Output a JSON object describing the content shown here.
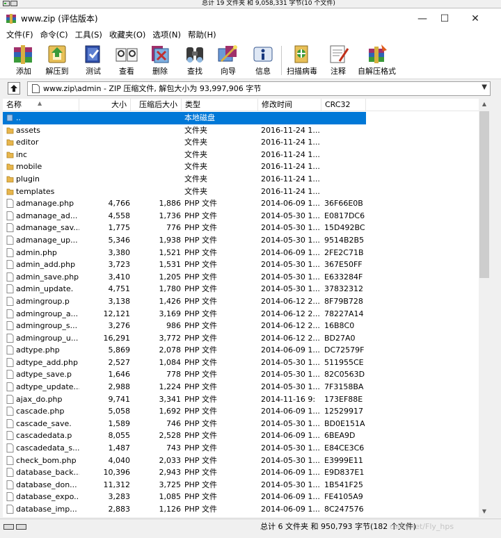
{
  "top_strip": {
    "text": "总计 19 文件夹 和 9,058,331 字节(10 个文件)"
  },
  "window": {
    "title": "www.zip (评估版本)",
    "controls": {
      "minimize": "—",
      "maximize": "☐",
      "close": "✕"
    }
  },
  "menu": [
    "文件(F)",
    "命令(C)",
    "工具(S)",
    "收藏夹(O)",
    "选项(N)",
    "帮助(H)"
  ],
  "toolbar": [
    {
      "label": "添加",
      "icon": "add-icon"
    },
    {
      "label": "解压到",
      "icon": "extract-to-icon"
    },
    {
      "label": "测试",
      "icon": "test-icon"
    },
    {
      "label": "查看",
      "icon": "view-icon"
    },
    {
      "label": "删除",
      "icon": "delete-icon"
    },
    {
      "label": "查找",
      "icon": "find-icon"
    },
    {
      "label": "向导",
      "icon": "wizard-icon"
    },
    {
      "label": "信息",
      "icon": "info-icon"
    },
    {
      "label": "扫描病毒",
      "icon": "virus-scan-icon"
    },
    {
      "label": "注释",
      "icon": "comment-icon"
    },
    {
      "label": "自解压格式",
      "icon": "sfx-icon"
    }
  ],
  "address": {
    "text": "www.zip\\admin - ZIP 压缩文件, 解包大小为 93,997,906 字节"
  },
  "columns": {
    "name": "名称",
    "size": "大小",
    "packed": "压缩后大小",
    "type": "类型",
    "modified": "修改时间",
    "crc": "CRC32"
  },
  "rows": [
    {
      "kind": "up",
      "name": "..",
      "size": "",
      "packed": "",
      "type": "本地磁盘",
      "modified": "",
      "crc": "",
      "selected": true
    },
    {
      "kind": "folder",
      "name": "assets",
      "size": "",
      "packed": "",
      "type": "文件夹",
      "modified": "2016-11-24 1...",
      "crc": ""
    },
    {
      "kind": "folder",
      "name": "editor",
      "size": "",
      "packed": "",
      "type": "文件夹",
      "modified": "2016-11-24 1...",
      "crc": ""
    },
    {
      "kind": "folder",
      "name": "inc",
      "size": "",
      "packed": "",
      "type": "文件夹",
      "modified": "2016-11-24 1...",
      "crc": ""
    },
    {
      "kind": "folder",
      "name": "mobile",
      "size": "",
      "packed": "",
      "type": "文件夹",
      "modified": "2016-11-24 1...",
      "crc": ""
    },
    {
      "kind": "folder",
      "name": "plugin",
      "size": "",
      "packed": "",
      "type": "文件夹",
      "modified": "2016-11-24 1...",
      "crc": ""
    },
    {
      "kind": "folder",
      "name": "templates",
      "size": "",
      "packed": "",
      "type": "文件夹",
      "modified": "2016-11-24 1...",
      "crc": ""
    },
    {
      "kind": "file",
      "name": "admanage.php",
      "size": "4,766",
      "packed": "1,886",
      "type": "PHP 文件",
      "modified": "2014-06-09 1...",
      "crc": "36F66E0B"
    },
    {
      "kind": "file",
      "name": "admanage_ad...",
      "size": "4,558",
      "packed": "1,736",
      "type": "PHP 文件",
      "modified": "2014-05-30 1...",
      "crc": "E0817DC6"
    },
    {
      "kind": "file",
      "name": "admanage_sav...",
      "size": "1,775",
      "packed": "776",
      "type": "PHP 文件",
      "modified": "2014-05-30 1...",
      "crc": "15D492BC"
    },
    {
      "kind": "file",
      "name": "admanage_up...",
      "size": "5,346",
      "packed": "1,938",
      "type": "PHP 文件",
      "modified": "2014-05-30 1...",
      "crc": "9514B2B5"
    },
    {
      "kind": "file",
      "name": "admin.php",
      "size": "3,380",
      "packed": "1,521",
      "type": "PHP 文件",
      "modified": "2014-06-09 1...",
      "crc": "2FE2C71B"
    },
    {
      "kind": "file",
      "name": "admin_add.php",
      "size": "3,723",
      "packed": "1,531",
      "type": "PHP 文件",
      "modified": "2014-05-30 1...",
      "crc": "367E50FF"
    },
    {
      "kind": "file",
      "name": "admin_save.php",
      "size": "3,410",
      "packed": "1,205",
      "type": "PHP 文件",
      "modified": "2014-05-30 1...",
      "crc": "E633284F"
    },
    {
      "kind": "file",
      "name": "admin_update.",
      "size": "4,751",
      "packed": "1,780",
      "type": "PHP 文件",
      "modified": "2014-05-30 1...",
      "crc": "37832312"
    },
    {
      "kind": "file",
      "name": "admingroup.p",
      "size": "3,138",
      "packed": "1,426",
      "type": "PHP 文件",
      "modified": "2014-06-12 2...",
      "crc": "8F79B728"
    },
    {
      "kind": "file",
      "name": "admingroup_a...",
      "size": "12,121",
      "packed": "3,169",
      "type": "PHP 文件",
      "modified": "2014-06-12 2...",
      "crc": "78227A14"
    },
    {
      "kind": "file",
      "name": "admingroup_s...",
      "size": "3,276",
      "packed": "986",
      "type": "PHP 文件",
      "modified": "2014-06-12 2...",
      "crc": "16B8C0"
    },
    {
      "kind": "file",
      "name": "admingroup_u...",
      "size": "16,291",
      "packed": "3,772",
      "type": "PHP 文件",
      "modified": "2014-06-12 2...",
      "crc": "BD27A0"
    },
    {
      "kind": "file",
      "name": "adtype.php",
      "size": "5,869",
      "packed": "2,078",
      "type": "PHP 文件",
      "modified": "2014-06-09 1...",
      "crc": "DC72579F"
    },
    {
      "kind": "file",
      "name": "adtype_add.php",
      "size": "2,527",
      "packed": "1,084",
      "type": "PHP 文件",
      "modified": "2014-05-30 1...",
      "crc": "511955CE"
    },
    {
      "kind": "file",
      "name": "adtype_save.p",
      "size": "1,646",
      "packed": "778",
      "type": "PHP 文件",
      "modified": "2014-05-30 1...",
      "crc": "82C0563D"
    },
    {
      "kind": "file",
      "name": "adtype_update...",
      "size": "2,988",
      "packed": "1,224",
      "type": "PHP 文件",
      "modified": "2014-05-30 1...",
      "crc": "7F3158BA"
    },
    {
      "kind": "file",
      "name": "ajax_do.php",
      "size": "9,741",
      "packed": "3,341",
      "type": "PHP 文件",
      "modified": "2014-11-16 9:",
      "crc": "173EF88E"
    },
    {
      "kind": "file",
      "name": "cascade.php",
      "size": "5,058",
      "packed": "1,692",
      "type": "PHP 文件",
      "modified": "2014-06-09 1...",
      "crc": "12529917"
    },
    {
      "kind": "file",
      "name": "cascade_save.",
      "size": "1,589",
      "packed": "746",
      "type": "PHP 文件",
      "modified": "2014-05-30 1...",
      "crc": "BD0E151A"
    },
    {
      "kind": "file",
      "name": "cascadedata.p",
      "size": "8,055",
      "packed": "2,528",
      "type": "PHP 文件",
      "modified": "2014-06-09 1...",
      "crc": "6BEA9D"
    },
    {
      "kind": "file",
      "name": "cascadedata_s...",
      "size": "1,487",
      "packed": "743",
      "type": "PHP 文件",
      "modified": "2014-05-30 1...",
      "crc": "E84CE3C6"
    },
    {
      "kind": "file",
      "name": "check_bom.php",
      "size": "4,040",
      "packed": "2,033",
      "type": "PHP 文件",
      "modified": "2014-05-30 1...",
      "crc": "E3999E11"
    },
    {
      "kind": "file",
      "name": "database_back...",
      "size": "10,396",
      "packed": "2,943",
      "type": "PHP 文件",
      "modified": "2014-06-09 1...",
      "crc": "E9D837E1"
    },
    {
      "kind": "file",
      "name": "database_don...",
      "size": "11,312",
      "packed": "3,725",
      "type": "PHP 文件",
      "modified": "2014-05-30 1...",
      "crc": "1B541F25"
    },
    {
      "kind": "file",
      "name": "database_expo...",
      "size": "3,283",
      "packed": "1,085",
      "type": "PHP 文件",
      "modified": "2014-06-09 1...",
      "crc": "FE4105A9"
    },
    {
      "kind": "file",
      "name": "database_imp...",
      "size": "2,883",
      "packed": "1,126",
      "type": "PHP 文件",
      "modified": "2014-06-09 1...",
      "crc": "8C247576"
    }
  ],
  "status": {
    "text": "总计 6 文件夹 和 950,793 字节(182 个文件)",
    "watermark": "csdn.net/Fly_hps"
  },
  "colors": {
    "selection": "#0078d7",
    "folder": "#e8b64c",
    "window_bg": "#f0f0f0"
  }
}
